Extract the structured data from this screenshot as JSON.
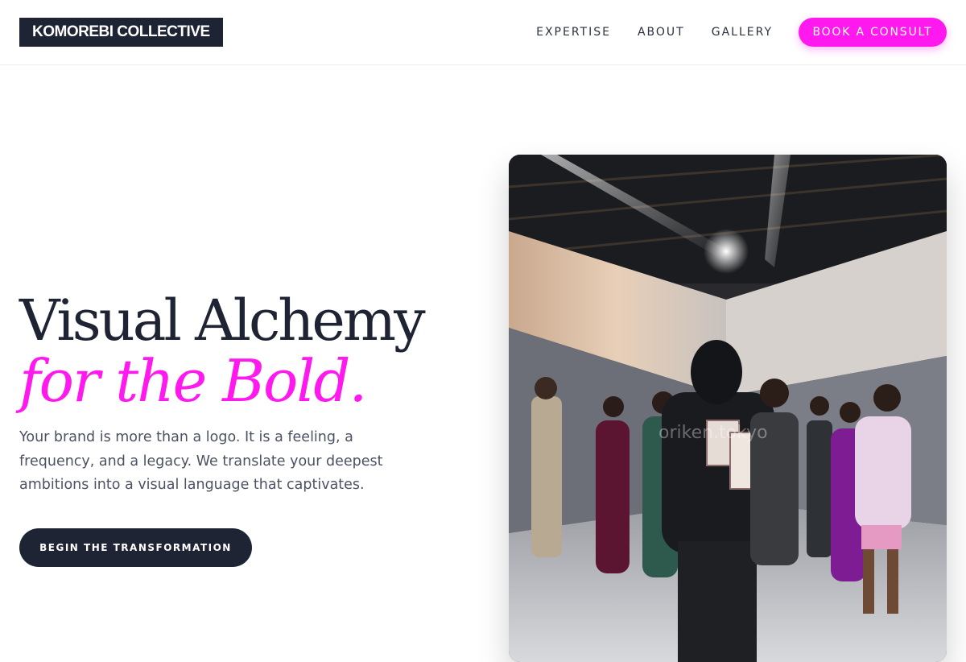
{
  "brand": {
    "logo_text": "KOMOREBI COLLECTIVE"
  },
  "nav": {
    "links": [
      "EXPERTISE",
      "ABOUT",
      "GALLERY"
    ],
    "cta_label": "BOOK A CONSULT"
  },
  "hero": {
    "title_line1": "Visual Alchemy",
    "title_line2": "for the Bold.",
    "description": "Your brand is more than a logo. It is a feeling, a frequency, and a legacy. We translate your deepest ambitions into a visual language that captivates.",
    "cta_label": "BEGIN THE TRANSFORMATION",
    "image_watermark": "oriken.tokyo"
  },
  "colors": {
    "accent": "#ff19ef",
    "navy": "#1e2433",
    "body_text": "#4b5263"
  }
}
